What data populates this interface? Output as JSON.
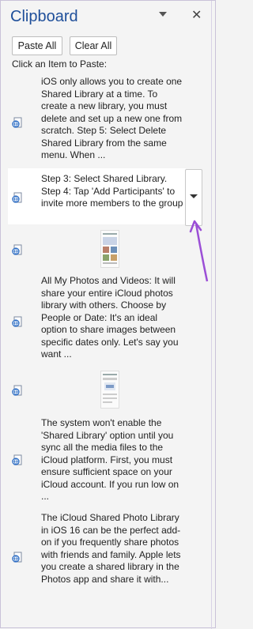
{
  "pane": {
    "title": "Clipboard",
    "paste_all_label": "Paste All",
    "clear_all_label": "Clear All",
    "hint": "Click an Item to Paste:"
  },
  "items": [
    {
      "type": "text",
      "text": "iOS only allows you to create one Shared Library at a time. To create a new library, you must delete and set up a new one from scratch. Step 5: Select Delete Shared Library from the same menu. When ..."
    },
    {
      "type": "text",
      "text": "Step 3: Select Shared Library. Step 4: Tap 'Add Participants' to invite more members to the group",
      "selected": true
    },
    {
      "type": "image"
    },
    {
      "type": "text",
      "text": "All My Photos and Videos: It will share your entire iCloud photos library with others. Choose by People or Date: It's an ideal option to share images between specific dates only. Let's say you want ..."
    },
    {
      "type": "image"
    },
    {
      "type": "text",
      "text": "The system won't enable the 'Shared Library' option until you sync all the media files to the iCloud platform. First, you must ensure sufficient space on your iCloud account. If you run low on ..."
    },
    {
      "type": "text",
      "text": "The iCloud Shared Photo Library in iOS 16 can be the perfect add-on if you frequently share photos with friends and family. Apple lets you create a shared library in the Photos app and share it with..."
    }
  ],
  "colors": {
    "title": "#1f4f9a",
    "annotation_arrow": "#9b4fd6"
  },
  "icons": {
    "item_icon": "web-globe-doc-icon",
    "item_menu": "dropdown-arrow-icon",
    "pane_options": "chevron-down-icon",
    "close": "close-icon"
  }
}
